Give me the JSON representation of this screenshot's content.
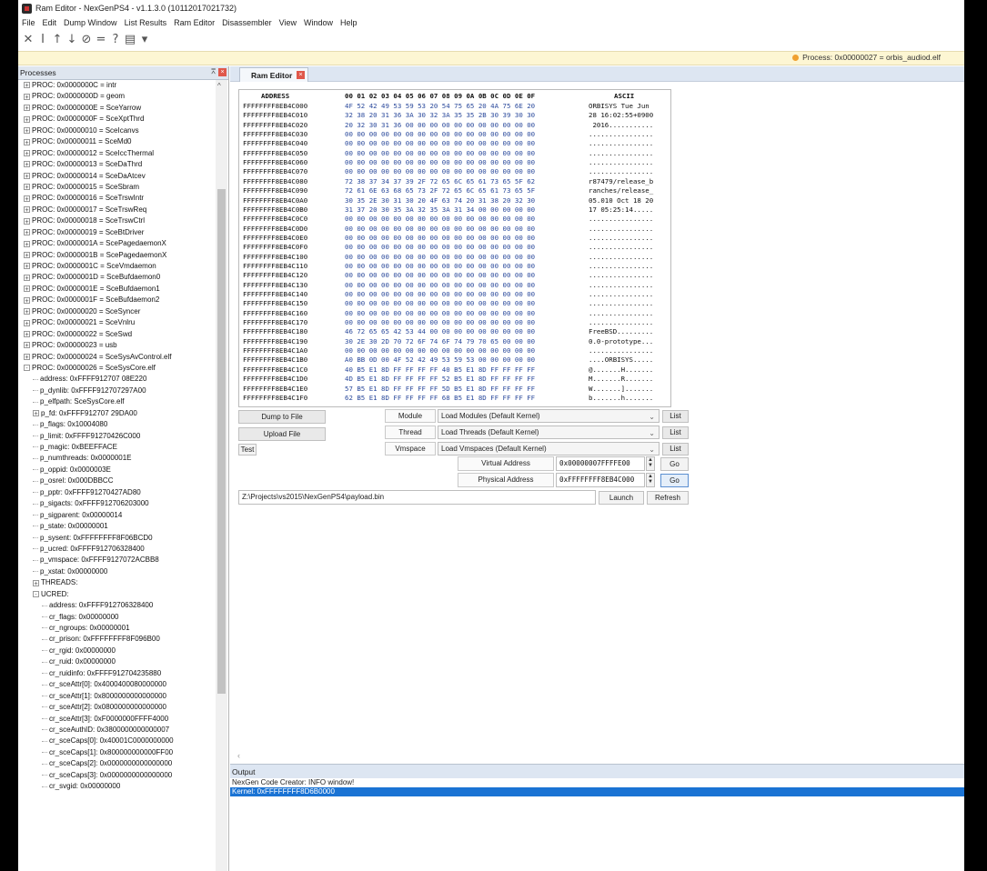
{
  "window": {
    "title": "Ram Editor - NexGenPS4 - v1.1.3.0 (10112017021732)"
  },
  "menu": [
    "File",
    "Edit",
    "Dump Window",
    "List Results",
    "Ram Editor",
    "Disassembler",
    "View",
    "Window",
    "Help"
  ],
  "toolbar": {
    "icons": [
      "cross-icon",
      "cursor-icon",
      "arrow-up-icon",
      "arrow-down-icon",
      "no-entry-icon",
      "equals-icon",
      "question-icon",
      "save-icon",
      "dropdown-icon"
    ],
    "glyphs": [
      "✕",
      "I",
      "↑",
      "↓",
      "⊘",
      "=",
      "?",
      "▤",
      "▾"
    ]
  },
  "status": {
    "process": "Process: 0x00000027 = orbis_audiod.elf",
    "dot_color": "#f0a030"
  },
  "processes_panel": {
    "title": "Processes",
    "items": [
      {
        "t": "PROC: 0x0000000C = intr",
        "d": 0,
        "e": "+"
      },
      {
        "t": "PROC: 0x0000000D = geom",
        "d": 0,
        "e": "+"
      },
      {
        "t": "PROC: 0x0000000E = SceYarrow",
        "d": 0,
        "e": "+"
      },
      {
        "t": "PROC: 0x0000000F = SceXptThrd",
        "d": 0,
        "e": "+"
      },
      {
        "t": "PROC: 0x00000010 = SceIcanvs",
        "d": 0,
        "e": "+"
      },
      {
        "t": "PROC: 0x00000011 = SceMd0",
        "d": 0,
        "e": "+"
      },
      {
        "t": "PROC: 0x00000012 = SceIccThermal",
        "d": 0,
        "e": "+"
      },
      {
        "t": "PROC: 0x00000013 = SceDaThrd",
        "d": 0,
        "e": "+"
      },
      {
        "t": "PROC: 0x00000014 = SceDaAtcev",
        "d": 0,
        "e": "+"
      },
      {
        "t": "PROC: 0x00000015 = SceSbram",
        "d": 0,
        "e": "+"
      },
      {
        "t": "PROC: 0x00000016 = SceTrswIntr",
        "d": 0,
        "e": "+"
      },
      {
        "t": "PROC: 0x00000017 = SceTrswReq",
        "d": 0,
        "e": "+"
      },
      {
        "t": "PROC: 0x00000018 = SceTrswCtrl",
        "d": 0,
        "e": "+"
      },
      {
        "t": "PROC: 0x00000019 = SceBtDriver",
        "d": 0,
        "e": "+"
      },
      {
        "t": "PROC: 0x0000001A = ScePagedaemonX",
        "d": 0,
        "e": "+"
      },
      {
        "t": "PROC: 0x0000001B = ScePagedaemonX",
        "d": 0,
        "e": "+"
      },
      {
        "t": "PROC: 0x0000001C = SceVmdaemon",
        "d": 0,
        "e": "+"
      },
      {
        "t": "PROC: 0x0000001D = SceBufdaemon0",
        "d": 0,
        "e": "+"
      },
      {
        "t": "PROC: 0x0000001E = SceBufdaemon1",
        "d": 0,
        "e": "+"
      },
      {
        "t": "PROC: 0x0000001F = SceBufdaemon2",
        "d": 0,
        "e": "+"
      },
      {
        "t": "PROC: 0x00000020 = SceSyncer",
        "d": 0,
        "e": "+"
      },
      {
        "t": "PROC: 0x00000021 = SceVnlru",
        "d": 0,
        "e": "+"
      },
      {
        "t": "PROC: 0x00000022 = SceSwd",
        "d": 0,
        "e": "+"
      },
      {
        "t": "PROC: 0x00000023 = usb",
        "d": 0,
        "e": "+"
      },
      {
        "t": "PROC: 0x00000024 = SceSysAvControl.elf",
        "d": 0,
        "e": "+"
      },
      {
        "t": "PROC: 0x00000026 = SceSysCore.elf",
        "d": 0,
        "e": "-"
      },
      {
        "t": "address: 0xFFFF912707 08E220",
        "d": 1,
        "e": ""
      },
      {
        "t": "p_dynlib: 0xFFFF912707297A00",
        "d": 1,
        "e": ""
      },
      {
        "t": "p_elfpath: SceSysCore.elf",
        "d": 1,
        "e": ""
      },
      {
        "t": "p_fd: 0xFFFF912707 29DA00",
        "d": 1,
        "e": "+"
      },
      {
        "t": "p_flags: 0x10004080",
        "d": 1,
        "e": ""
      },
      {
        "t": "p_limit: 0xFFFF91270426C000",
        "d": 1,
        "e": ""
      },
      {
        "t": "p_magic: 0xBEEFFACE",
        "d": 1,
        "e": ""
      },
      {
        "t": "p_numthreads: 0x0000001E",
        "d": 1,
        "e": ""
      },
      {
        "t": "p_oppid: 0x0000003E",
        "d": 1,
        "e": ""
      },
      {
        "t": "p_osrel: 0x000DBBCC",
        "d": 1,
        "e": ""
      },
      {
        "t": "p_pptr: 0xFFFF91270427AD80",
        "d": 1,
        "e": ""
      },
      {
        "t": "p_sigacts: 0xFFFF912706203000",
        "d": 1,
        "e": ""
      },
      {
        "t": "p_sigparent: 0x00000014",
        "d": 1,
        "e": ""
      },
      {
        "t": "p_state: 0x00000001",
        "d": 1,
        "e": ""
      },
      {
        "t": "p_sysent: 0xFFFFFFFF8F06BCD0",
        "d": 1,
        "e": ""
      },
      {
        "t": "p_ucred: 0xFFFF912706328400",
        "d": 1,
        "e": ""
      },
      {
        "t": "p_vmspace: 0xFFFF9127072ACBB8",
        "d": 1,
        "e": ""
      },
      {
        "t": "p_xstat: 0x00000000",
        "d": 1,
        "e": ""
      },
      {
        "t": "THREADS:",
        "d": 1,
        "e": "+"
      },
      {
        "t": "UCRED:",
        "d": 1,
        "e": "-"
      },
      {
        "t": "address: 0xFFFF912706328400",
        "d": 2,
        "e": ""
      },
      {
        "t": "cr_flags: 0x00000000",
        "d": 2,
        "e": ""
      },
      {
        "t": "cr_ngroups: 0x00000001",
        "d": 2,
        "e": ""
      },
      {
        "t": "cr_prison: 0xFFFFFFFF8F096B00",
        "d": 2,
        "e": ""
      },
      {
        "t": "cr_rgid: 0x00000000",
        "d": 2,
        "e": ""
      },
      {
        "t": "cr_ruid: 0x00000000",
        "d": 2,
        "e": ""
      },
      {
        "t": "cr_ruidinfo: 0xFFFF912704235880",
        "d": 2,
        "e": ""
      },
      {
        "t": "cr_sceAttr[0]: 0x4000400080000000",
        "d": 2,
        "e": ""
      },
      {
        "t": "cr_sceAttr[1]: 0x8000000000000000",
        "d": 2,
        "e": ""
      },
      {
        "t": "cr_sceAttr[2]: 0x0800000000000000",
        "d": 2,
        "e": ""
      },
      {
        "t": "cr_sceAttr[3]: 0xF0000000FFFF4000",
        "d": 2,
        "e": ""
      },
      {
        "t": "cr_sceAuthID: 0x3800000000000007",
        "d": 2,
        "e": ""
      },
      {
        "t": "cr_sceCaps[0]: 0x40001C0000000000",
        "d": 2,
        "e": ""
      },
      {
        "t": "cr_sceCaps[1]: 0x800000000000FF00",
        "d": 2,
        "e": ""
      },
      {
        "t": "cr_sceCaps[2]: 0x0000000000000000",
        "d": 2,
        "e": ""
      },
      {
        "t": "cr_sceCaps[3]: 0x0000000000000000",
        "d": 2,
        "e": ""
      },
      {
        "t": "cr_svgid: 0x00000000",
        "d": 2,
        "e": ""
      }
    ]
  },
  "tab": {
    "label": "Ram Editor"
  },
  "hex": {
    "header_address": "ADDRESS",
    "header_bytes": "00 01 02 03 04 05 06 07 08 09 0A 0B 0C 0D 0E 0F",
    "header_ascii": "ASCII",
    "rows": [
      {
        "a": "FFFFFFFF8EB4C000",
        "h": "4F 52 42 49 53 59 53 20 54 75 65 20 4A 75 6E 20",
        "s": "ORBISYS Tue Jun "
      },
      {
        "a": "FFFFFFFF8EB4C010",
        "h": "32 38 20 31 36 3A 30 32 3A 35 35 2B 30 39 30 30",
        "s": "28 16:02:55+0900"
      },
      {
        "a": "FFFFFFFF8EB4C020",
        "h": "20 32 30 31 36 00 00 00 00 00 00 00 00 00 00 00",
        "s": " 2016..........."
      },
      {
        "a": "FFFFFFFF8EB4C030",
        "h": "00 00 00 00 00 00 00 00 00 00 00 00 00 00 00 00",
        "s": "................"
      },
      {
        "a": "FFFFFFFF8EB4C040",
        "h": "00 00 00 00 00 00 00 00 00 00 00 00 00 00 00 00",
        "s": "................"
      },
      {
        "a": "FFFFFFFF8EB4C050",
        "h": "00 00 00 00 00 00 00 00 00 00 00 00 00 00 00 00",
        "s": "................"
      },
      {
        "a": "FFFFFFFF8EB4C060",
        "h": "00 00 00 00 00 00 00 00 00 00 00 00 00 00 00 00",
        "s": "................"
      },
      {
        "a": "FFFFFFFF8EB4C070",
        "h": "00 00 00 00 00 00 00 00 00 00 00 00 00 00 00 00",
        "s": "................"
      },
      {
        "a": "FFFFFFFF8EB4C080",
        "h": "72 38 37 34 37 39 2F 72 65 6C 65 61 73 65 5F 62",
        "s": "r87479/release_b"
      },
      {
        "a": "FFFFFFFF8EB4C090",
        "h": "72 61 6E 63 68 65 73 2F 72 65 6C 65 61 73 65 5F",
        "s": "ranches/release_"
      },
      {
        "a": "FFFFFFFF8EB4C0A0",
        "h": "30 35 2E 30 31 30 20 4F 63 74 20 31 38 20 32 30",
        "s": "05.010 Oct 18 20"
      },
      {
        "a": "FFFFFFFF8EB4C0B0",
        "h": "31 37 20 30 35 3A 32 35 3A 31 34 00 00 00 00 00",
        "s": "17 05:25:14....."
      },
      {
        "a": "FFFFFFFF8EB4C0C0",
        "h": "00 00 00 00 00 00 00 00 00 00 00 00 00 00 00 00",
        "s": "................"
      },
      {
        "a": "FFFFFFFF8EB4C0D0",
        "h": "00 00 00 00 00 00 00 00 00 00 00 00 00 00 00 00",
        "s": "................"
      },
      {
        "a": "FFFFFFFF8EB4C0E0",
        "h": "00 00 00 00 00 00 00 00 00 00 00 00 00 00 00 00",
        "s": "................"
      },
      {
        "a": "FFFFFFFF8EB4C0F0",
        "h": "00 00 00 00 00 00 00 00 00 00 00 00 00 00 00 00",
        "s": "................"
      },
      {
        "a": "FFFFFFFF8EB4C100",
        "h": "00 00 00 00 00 00 00 00 00 00 00 00 00 00 00 00",
        "s": "................"
      },
      {
        "a": "FFFFFFFF8EB4C110",
        "h": "00 00 00 00 00 00 00 00 00 00 00 00 00 00 00 00",
        "s": "................"
      },
      {
        "a": "FFFFFFFF8EB4C120",
        "h": "00 00 00 00 00 00 00 00 00 00 00 00 00 00 00 00",
        "s": "................"
      },
      {
        "a": "FFFFFFFF8EB4C130",
        "h": "00 00 00 00 00 00 00 00 00 00 00 00 00 00 00 00",
        "s": "................"
      },
      {
        "a": "FFFFFFFF8EB4C140",
        "h": "00 00 00 00 00 00 00 00 00 00 00 00 00 00 00 00",
        "s": "................"
      },
      {
        "a": "FFFFFFFF8EB4C150",
        "h": "00 00 00 00 00 00 00 00 00 00 00 00 00 00 00 00",
        "s": "................"
      },
      {
        "a": "FFFFFFFF8EB4C160",
        "h": "00 00 00 00 00 00 00 00 00 00 00 00 00 00 00 00",
        "s": "................"
      },
      {
        "a": "FFFFFFFF8EB4C170",
        "h": "00 00 00 00 00 00 00 00 00 00 00 00 00 00 00 00",
        "s": "................"
      },
      {
        "a": "FFFFFFFF8EB4C180",
        "h": "46 72 65 65 42 53 44 00 00 00 00 00 00 00 00 00",
        "s": "FreeBSD........."
      },
      {
        "a": "FFFFFFFF8EB4C190",
        "h": "30 2E 30 2D 70 72 6F 74 6F 74 79 70 65 00 00 00",
        "s": "0.0-prototype..."
      },
      {
        "a": "FFFFFFFF8EB4C1A0",
        "h": "00 00 00 00 00 00 00 00 00 00 00 00 00 00 00 00",
        "s": "................"
      },
      {
        "a": "FFFFFFFF8EB4C1B0",
        "h": "A0 BB 0D 00 4F 52 42 49 53 59 53 00 00 00 00 00",
        "s": "....ORBISYS....."
      },
      {
        "a": "FFFFFFFF8EB4C1C0",
        "h": "40 B5 E1 8D FF FF FF FF 40 B5 E1 8D FF FF FF FF",
        "s": "@.......H......."
      },
      {
        "a": "FFFFFFFF8EB4C1D0",
        "h": "4D B5 E1 8D FF FF FF FF 52 B5 E1 8D FF FF FF FF",
        "s": "M.......R......."
      },
      {
        "a": "FFFFFFFF8EB4C1E0",
        "h": "57 B5 E1 8D FF FF FF FF 5D B5 E1 8D FF FF FF FF",
        "s": "W.......]......."
      },
      {
        "a": "FFFFFFFF8EB4C1F0",
        "h": "62 B5 E1 8D FF FF FF FF 68 B5 E1 8D FF FF FF FF",
        "s": "b.......h......."
      }
    ]
  },
  "controls": {
    "dump_to_file": "Dump to File",
    "upload_file": "Upload File",
    "test": "Test",
    "module_label": "Module",
    "thread_label": "Thread",
    "vmspace_label": "Vmspace",
    "module_combo": "Load Modules (Default Kernel)",
    "thread_combo": "Load Threads (Default Kernel)",
    "vmspace_combo": "Load Vmspaces (Default Kernel)",
    "list": "List",
    "virtual_address_label": "Virtual Address",
    "physical_address_label": "Physical Address",
    "virtual_address": "0x00000007FFFFE00",
    "physical_address": "0xFFFFFFFF8EB4C000",
    "go": "Go",
    "payload_path": "Z:\\Projects\\vs2015\\NexGenPS4\\payload.bin",
    "launch": "Launch",
    "refresh": "Refresh"
  },
  "output": {
    "title": "Output",
    "lines": [
      {
        "text": "NexGen Code Creator: INFO window!",
        "selected": false
      },
      {
        "text": "Kernel: 0xFFFFFFFF8D6B0000",
        "selected": true
      }
    ]
  }
}
